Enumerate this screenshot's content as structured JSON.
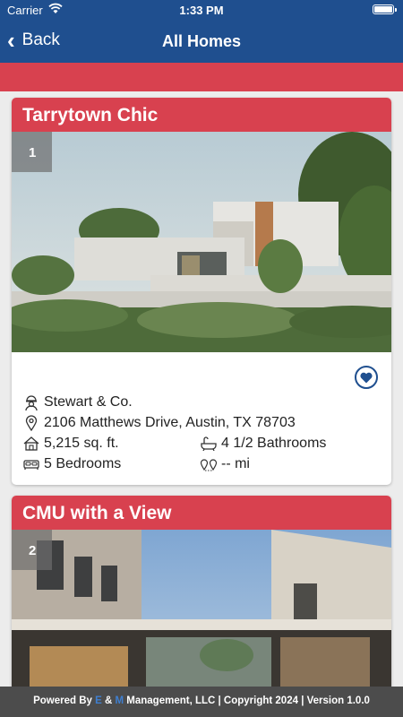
{
  "status_bar": {
    "carrier": "Carrier",
    "time": "1:33 PM"
  },
  "nav": {
    "back_label": "Back",
    "title": "All Homes"
  },
  "homes": [
    {
      "title": "Tarrytown Chic",
      "index": "1",
      "builder": "Stewart & Co.",
      "address": "2106 Matthews Drive, Austin, TX 78703",
      "sqft": "5,215 sq. ft.",
      "bathrooms": "4 1/2 Bathrooms",
      "bedrooms": "5 Bedrooms",
      "distance": "-- mi"
    },
    {
      "title": "CMU with a View",
      "index": "2"
    }
  ],
  "footer": {
    "prefix": "Powered By ",
    "e": "E",
    "amp": " & ",
    "m": "M",
    "suffix": " Management, LLC | Copyright 2024 | Version 1.0.0"
  },
  "colors": {
    "nav_blue": "#1f4f8f",
    "accent_red": "#d8414f",
    "footer_gray": "#4c4c4c"
  },
  "icons": [
    "chevron-left-icon",
    "wifi-icon",
    "battery-icon",
    "heart-icon",
    "builder-icon",
    "location-pin-icon",
    "house-icon",
    "bathtub-icon",
    "bed-icon",
    "distance-icon"
  ]
}
